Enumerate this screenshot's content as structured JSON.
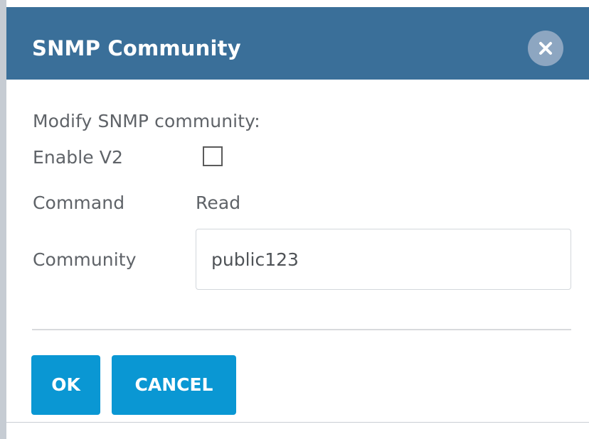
{
  "dialog": {
    "title": "SNMP Community",
    "intro": "Modify SNMP community:",
    "fields": {
      "enable_v2_label": "Enable V2",
      "enable_v2_checked": false,
      "command_label": "Command",
      "command_value": "Read",
      "community_label": "Community",
      "community_value": "public123"
    },
    "buttons": {
      "ok": "OK",
      "cancel": "CANCEL"
    },
    "icons": {
      "close": "close-icon",
      "checkbox": "checkbox-icon"
    }
  },
  "colors": {
    "title_bar": "#3a6f99",
    "close_circle": "#8da6c1",
    "primary_button": "#0a97d3",
    "text": "#5f6368"
  }
}
